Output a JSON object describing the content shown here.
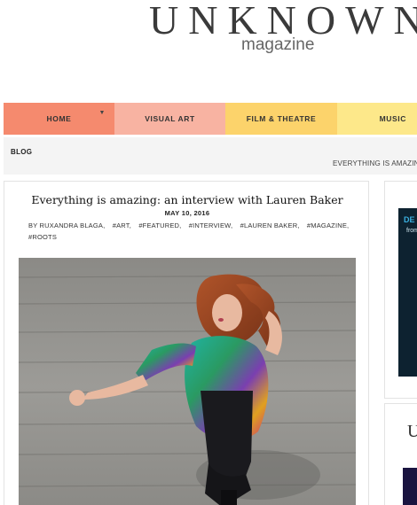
{
  "brand": {
    "name": "UNKNOWN",
    "subtitle": "magazine"
  },
  "nav": {
    "items": [
      {
        "label": "HOME",
        "color": "#f58a6e",
        "has_dropdown": true
      },
      {
        "label": "VISUAL ART",
        "color": "#f8b3a2"
      },
      {
        "label": "FILM & THEATRE",
        "color": "#fcd36b"
      },
      {
        "label": "MUSIC",
        "color": "#fde88a"
      }
    ]
  },
  "breadcrumb": {
    "section": "BLOG"
  },
  "ticker": {
    "text": "EVERYTHING IS AMAZIN"
  },
  "post": {
    "title": "Everything is amazing: an interview with Lauren Baker",
    "date": "MAY 10, 2016",
    "byline": "BY RUXANDRA BLAGA,",
    "tags": [
      "#ART,",
      "#FEATURED,",
      "#INTERVIEW,",
      "#LAUREN BAKER,",
      "#MAGAZINE,",
      "#ROOTS"
    ]
  },
  "sidebar": {
    "ad_text_1": "DE",
    "ad_text_2": "from",
    "heading_letter": "U"
  },
  "colors": {
    "accent_home": "#f58a6e",
    "accent_visual": "#f8b3a2",
    "accent_film": "#fcd36b",
    "accent_music": "#fde88a"
  }
}
